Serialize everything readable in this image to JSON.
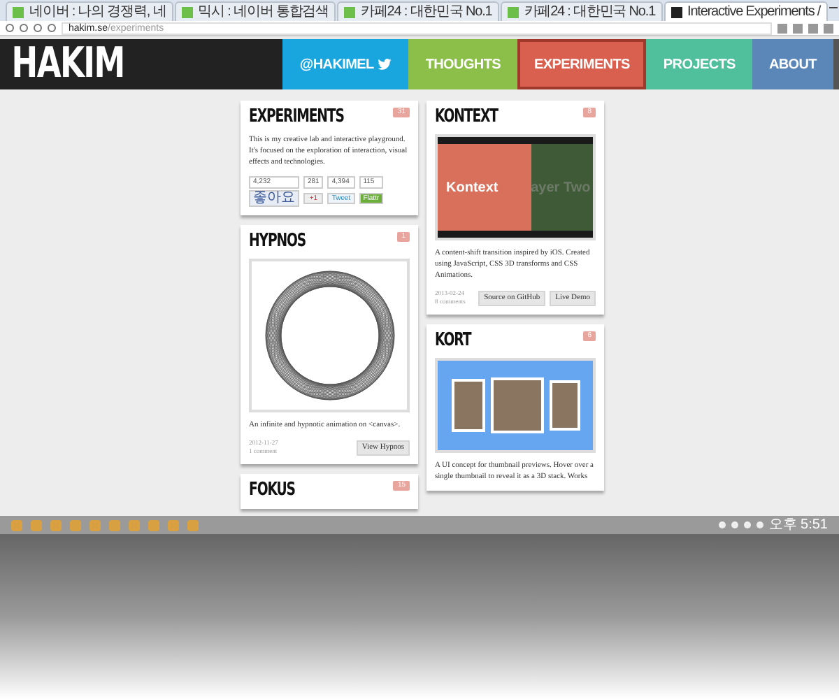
{
  "browser": {
    "tabs": [
      {
        "title": "네이버 : 나의 경쟁력, 네",
        "selected": false
      },
      {
        "title": "믹시 : 네이버 통합검색",
        "selected": false
      },
      {
        "title": "카페24 : 대한민국 No.1",
        "selected": false
      },
      {
        "title": "카페24 : 대한민국 No.1",
        "selected": false
      },
      {
        "title": "Interactive Experiments /",
        "selected": true
      }
    ],
    "url_host": "hakim.se",
    "url_path": "/experiments"
  },
  "site": {
    "logo": "HAKIM",
    "nav": [
      {
        "label": "@HAKIMEL",
        "color": "#19a6df",
        "selected": false,
        "twitter": true
      },
      {
        "label": "THOUGHTS",
        "color": "#8cbf4a",
        "selected": false,
        "twitter": false
      },
      {
        "label": "EXPERIMENTS",
        "color": "#d9604f",
        "selected": true,
        "twitter": false
      },
      {
        "label": "PROJECTS",
        "color": "#4fbf9c",
        "selected": false,
        "twitter": false
      },
      {
        "label": "ABOUT",
        "color": "#5b86b8",
        "selected": false,
        "twitter": false
      }
    ]
  },
  "columns": [
    [
      {
        "kind": "intro",
        "title": "EXPERIMENTS",
        "comments": "31",
        "text": "This is my creative lab and interactive playground. It's focused on the exploration of interaction, visual effects and technologies.",
        "counts": [
          "4,232",
          "281",
          "4,394",
          "115"
        ],
        "share": [
          "좋아요",
          "+1",
          "Tweet",
          "Flattr"
        ]
      },
      {
        "kind": "hypnos",
        "title": "HYPNOS",
        "comments": "1",
        "text": "An infinite and hypnotic animation on <canvas>.",
        "date": "2012-11-27",
        "comment_count": "1 comment",
        "buttons": [
          "View Hypnos"
        ]
      },
      {
        "kind": "plain",
        "title": "FOKUS",
        "comments": "15"
      }
    ],
    [
      {
        "kind": "kontext",
        "title": "KONTEXT",
        "comments": "8",
        "panel_left": "Kontext",
        "panel_right": "ayer Two",
        "text": "A content-shift transition inspired by iOS. Created using JavaScript, CSS 3D transforms and CSS Animations.",
        "date": "2013-02-24",
        "comment_count": "8 comments",
        "buttons": [
          "Source on GitHub",
          "Live Demo"
        ]
      },
      {
        "kind": "kort",
        "title": "KORT",
        "comments": "6",
        "text": "A UI concept for thumbnail previews. Hover over a single thumbnail to reveal it as a 3D stack. Works"
      }
    ]
  ],
  "taskbar": {
    "clock": "오후 5:51"
  }
}
